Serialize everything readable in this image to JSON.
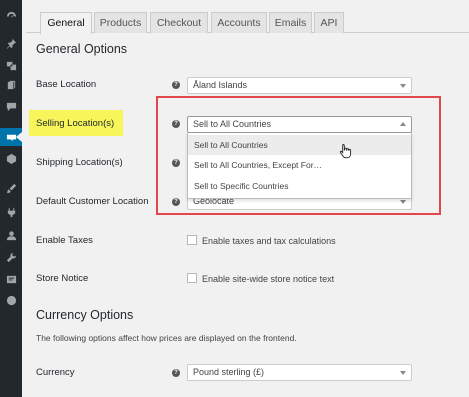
{
  "sidebar": {
    "icons": [
      "dashboard-icon",
      "pin-icon",
      "media-icon",
      "pages-icon",
      "comments-icon",
      "woocommerce-icon",
      "products-icon",
      "appearance-icon",
      "plugins-icon",
      "users-icon",
      "tools-icon",
      "settings-icon",
      "collapse-icon"
    ]
  },
  "tabs": [
    "General",
    "Products",
    "Checkout",
    "Accounts",
    "Emails",
    "API"
  ],
  "general_options": {
    "title": "General Options",
    "base_location": {
      "label": "Base Location",
      "value": "Åland Islands"
    },
    "selling_locations": {
      "label": "Selling Location(s)",
      "value": "Sell to All Countries",
      "options": [
        "Sell to All Countries",
        "Sell to All Countries, Except For…",
        "Sell to Specific Countries"
      ]
    },
    "shipping_locations": {
      "label": "Shipping Location(s)"
    },
    "default_customer_location": {
      "label": "Default Customer Location",
      "value": "Geolocate"
    },
    "enable_taxes": {
      "label": "Enable Taxes",
      "checkbox_label": "Enable taxes and tax calculations"
    },
    "store_notice": {
      "label": "Store Notice",
      "checkbox_label": "Enable site-wide store notice text"
    }
  },
  "currency_options": {
    "title": "Currency Options",
    "description": "The following options affect how prices are displayed on the frontend.",
    "currency": {
      "label": "Currency",
      "value": "Pound sterling (£)"
    }
  },
  "help_icon_text": "?",
  "colors": {
    "highlight": "#f6f55a",
    "annotation_box": "#e2474b",
    "sidebar_bg": "#23282d",
    "active_menu": "#0073aa"
  }
}
